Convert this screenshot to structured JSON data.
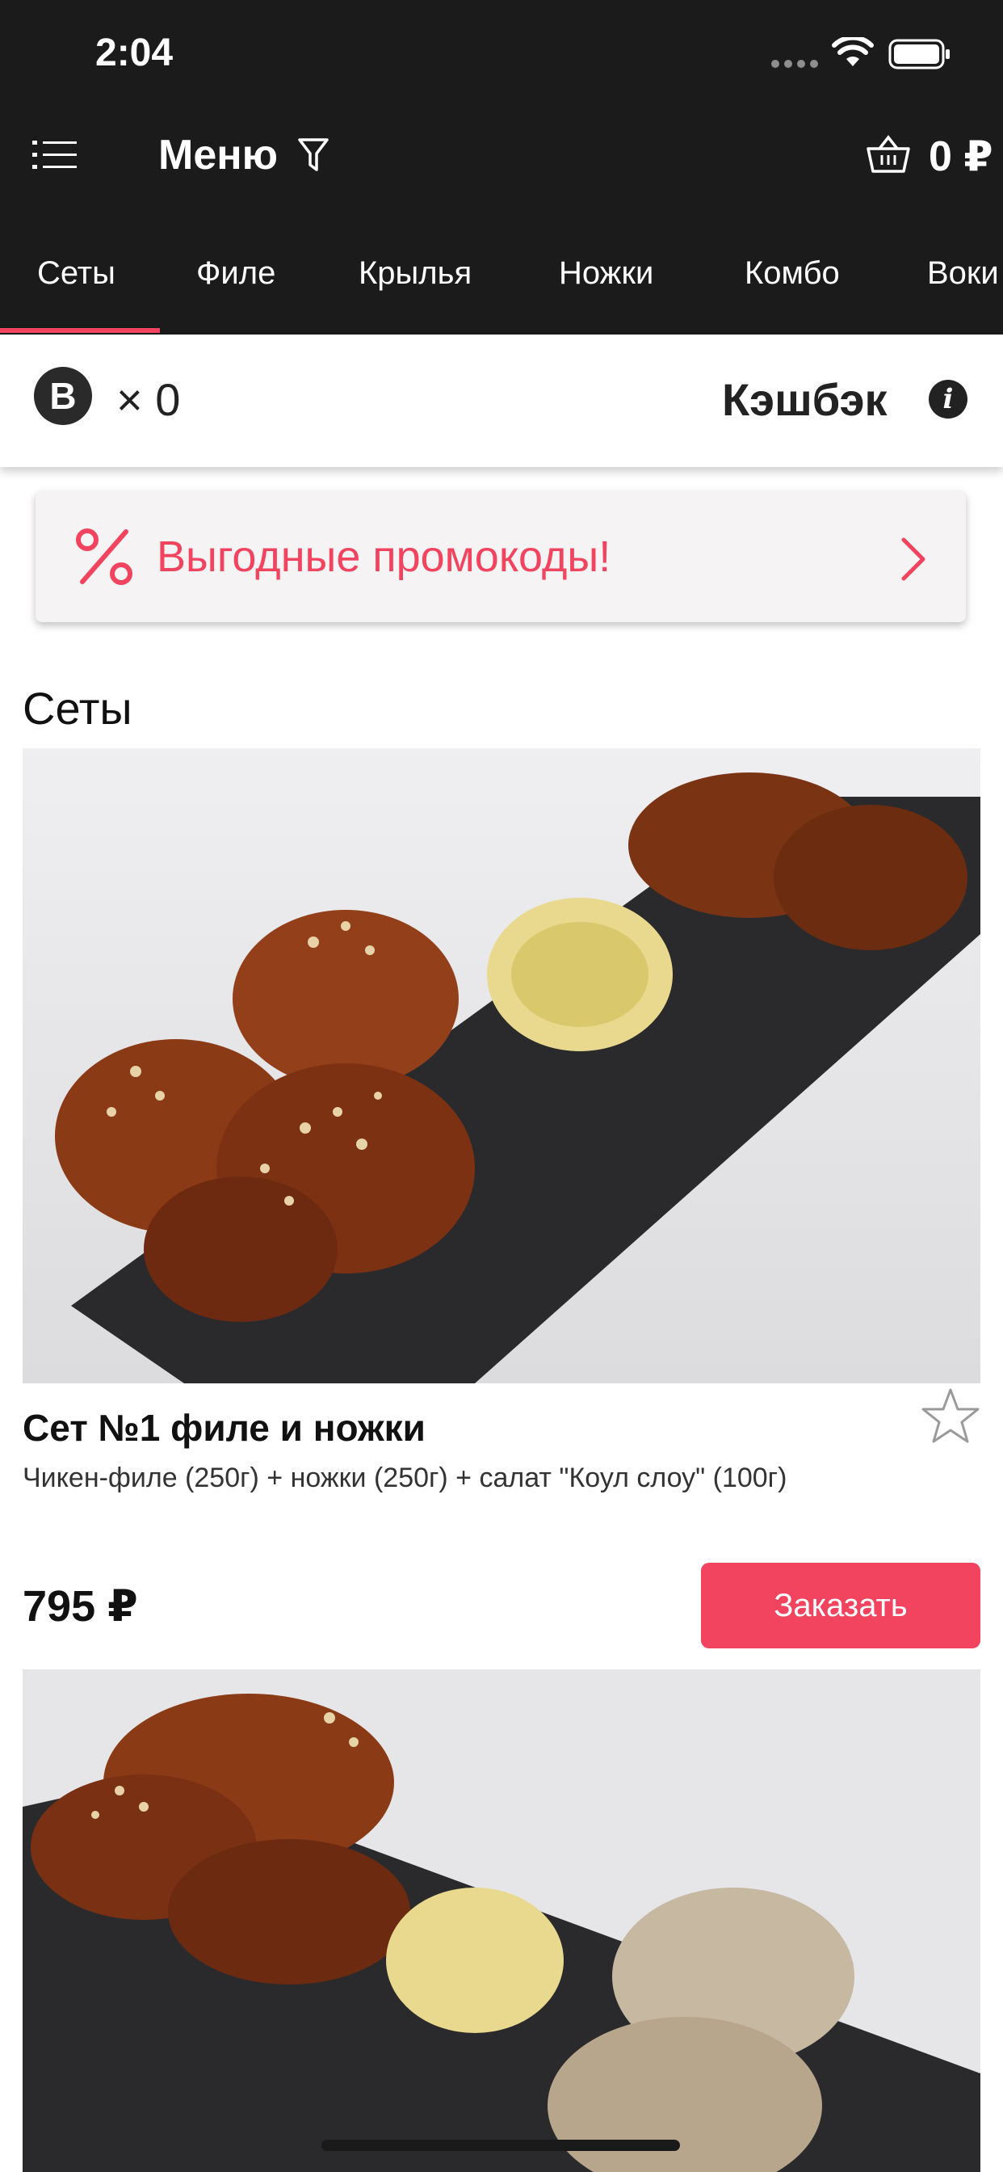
{
  "status_bar": {
    "time": "2:04"
  },
  "nav": {
    "title": "Меню",
    "basket_total": "0 ₽"
  },
  "tabs": [
    "Сеты",
    "Филе",
    "Крылья",
    "Ножки",
    "Комбо",
    "Воки"
  ],
  "active_tab_index": 0,
  "cashback": {
    "coin_symbol": "B",
    "count": "× 0",
    "label": "Кэшбэк"
  },
  "promo": {
    "text": "Выгодные промокоды!"
  },
  "section": {
    "title": "Сеты"
  },
  "products": [
    {
      "name": "Сет №1 филе и ножки",
      "description": "Чикен-филе (250г) + ножки (250г) + салат \"Коул слоу\" (100г)",
      "price": "795 ₽",
      "order_label": "Заказать"
    }
  ],
  "colors": {
    "accent": "#f3445f",
    "dark_bg": "#1c1b1c",
    "promo_bg": "#f5f3f3"
  },
  "icons": [
    "list-icon",
    "filter-icon",
    "basket-icon",
    "info-icon",
    "percent-icon",
    "chevron-right-icon",
    "star-icon"
  ]
}
